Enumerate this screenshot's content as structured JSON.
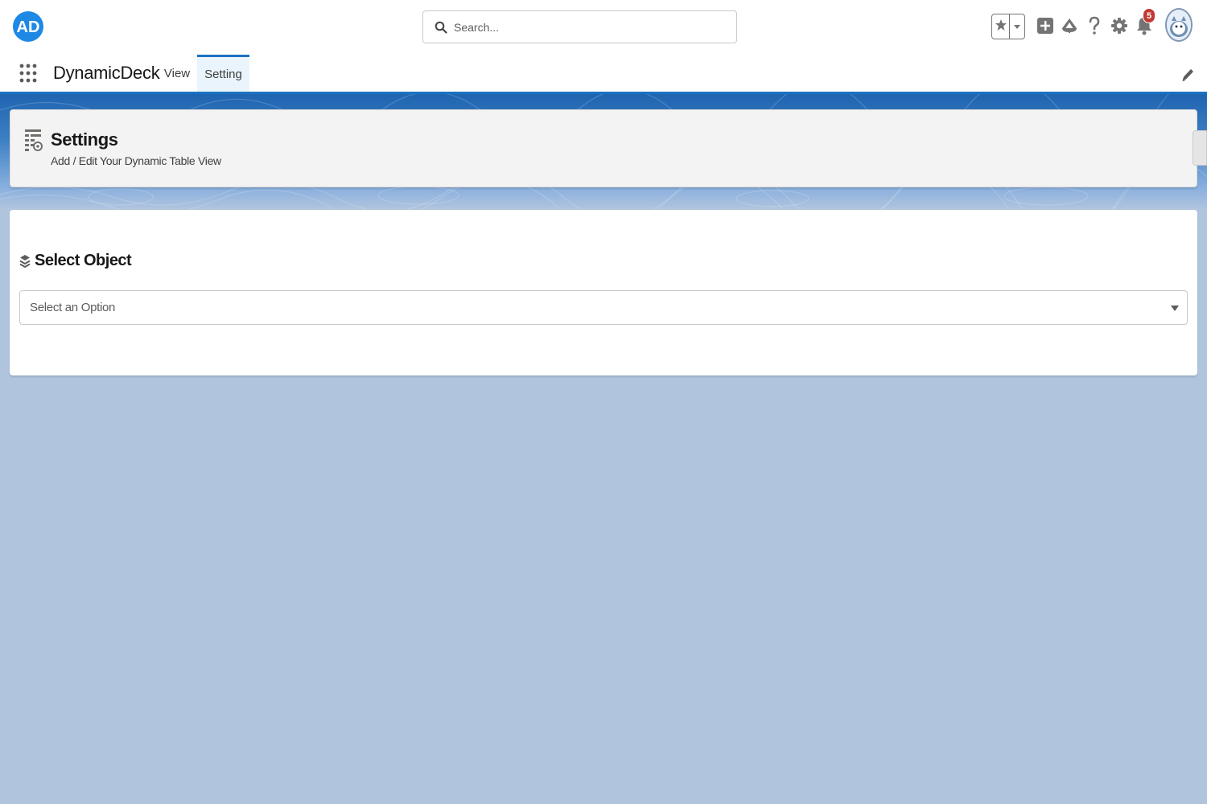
{
  "header": {
    "logo_alt": "AD",
    "search": {
      "placeholder": "Search...",
      "value": ""
    },
    "notifications_count": "5"
  },
  "app_nav": {
    "app_name": "DynamicDeck",
    "tabs": [
      {
        "label": "View",
        "active": false
      },
      {
        "label": "Setting",
        "active": true
      }
    ]
  },
  "page_header": {
    "title": "Settings",
    "subtitle": "Add / Edit Your Dynamic Table View"
  },
  "main": {
    "section_title": "Select Object",
    "object_select": {
      "placeholder": "Select an Option",
      "value": ""
    }
  },
  "icons": {
    "logo": "ad-logo-icon",
    "search": "search-icon",
    "favorites": "star-icon",
    "favorites_menu": "chevron-down-icon",
    "global_actions": "plus-icon",
    "trailhead": "trailhead-icon",
    "help": "question-icon",
    "setup": "gear-icon",
    "notifications": "bell-icon",
    "avatar": "avatar-icon",
    "app_launcher": "waffle-icon",
    "edit_nav": "pencil-icon",
    "page_header": "table-settings-icon",
    "section": "layers-icon",
    "select_caret": "caret-down-icon"
  },
  "colors": {
    "brand": "#1b72c0",
    "background": "#b0c4de",
    "badge": "#c23934",
    "active_tab_bg": "#eaf4fc"
  }
}
